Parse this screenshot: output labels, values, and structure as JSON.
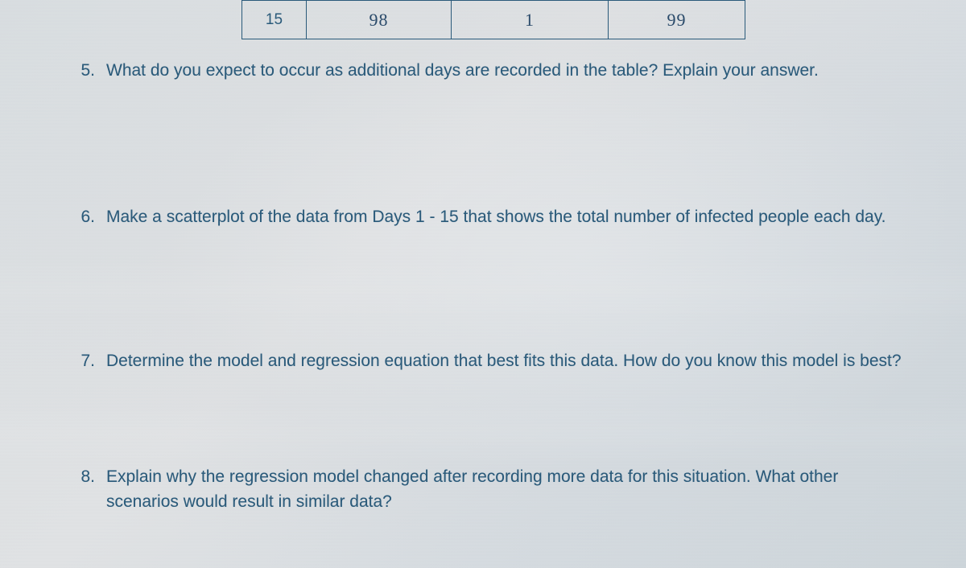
{
  "table": {
    "row": {
      "col1": "15",
      "col2_hand": "98",
      "col3_hand": "1",
      "col4_hand": "99"
    }
  },
  "questions": {
    "q5": {
      "num": "5.",
      "text": "What do you expect to occur as additional days are recorded in the table?  Explain your answer."
    },
    "q6": {
      "num": "6.",
      "text": "Make a scatterplot of the data from Days 1 - 15 that shows the total number of infected people each day."
    },
    "q7": {
      "num": "7.",
      "text": "Determine the model and regression equation that best fits this data.  How do you know this model is best?"
    },
    "q8": {
      "num": "8.",
      "text": "Explain why the regression model changed after recording more data for this situation.  What other scenarios would result in similar data?"
    }
  }
}
